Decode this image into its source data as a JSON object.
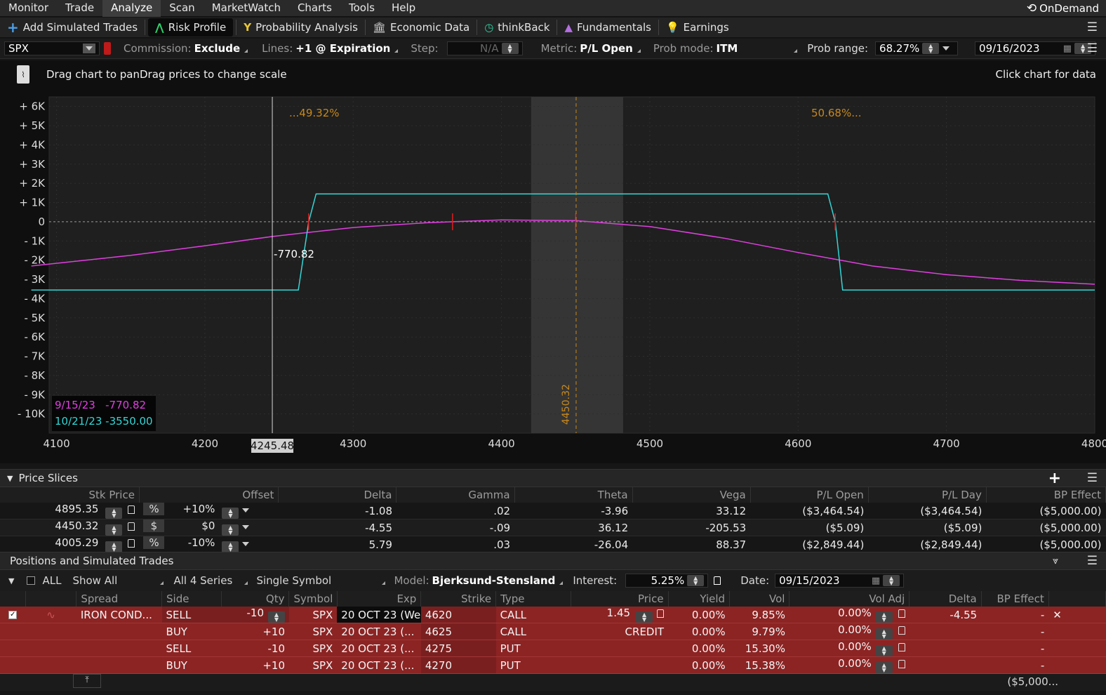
{
  "menu": [
    "Monitor",
    "Trade",
    "Analyze",
    "Scan",
    "MarketWatch",
    "Charts",
    "Tools",
    "Help"
  ],
  "menu_active": "Analyze",
  "ondemand": "OnDemand",
  "toolbar": {
    "add_simulated": "Add Simulated Trades",
    "risk_profile": "Risk Profile",
    "probability": "Probability Analysis",
    "economic": "Economic Data",
    "thinkback": "thinkBack",
    "fundamentals": "Fundamentals",
    "earnings": "Earnings"
  },
  "params": {
    "symbol": "SPX",
    "commission_label": "Commission:",
    "commission_value": "Exclude",
    "lines_label": "Lines:",
    "lines_value": "+1 @ Expiration",
    "step_label": "Step:",
    "step_value": "N/A",
    "metric_label": "Metric:",
    "metric_value": "P/L Open",
    "probmode_label": "Prob mode:",
    "probmode_value": "ITM",
    "probrange_label": "Prob range:",
    "probrange_value": "68.27%",
    "date_value": "09/16/2023"
  },
  "chart": {
    "hint": "Drag chart to panDrag prices to change scale",
    "click_hint": "Click chart for data",
    "left_prob": "...49.32%",
    "right_prob": "50.68%...",
    "price_marker": "4450.32",
    "cursor_price": "4245.48",
    "cursor_value": "-770.82",
    "legend": [
      {
        "date": "9/15/23",
        "value": "-770.82",
        "color": "#e040e0"
      },
      {
        "date": "10/21/23",
        "value": "-3550.00",
        "color": "#33d6d6"
      }
    ]
  },
  "chart_data": {
    "type": "line",
    "x_ticks": [
      4100,
      4200,
      4300,
      4400,
      4500,
      4600,
      4700,
      4800
    ],
    "y_ticks": [
      "+ 6K",
      "+ 5K",
      "+ 4K",
      "+ 3K",
      "+ 2K",
      "+ 1K",
      "0",
      "- 1K",
      "- 2K",
      "- 3K",
      "- 4K",
      "- 5K",
      "- 6K",
      "- 7K",
      "- 8K",
      "- 9K",
      "- 10K"
    ],
    "xlim": [
      4095,
      4800
    ],
    "ylim": [
      -11000,
      6500
    ],
    "shaded_range": [
      4420,
      4482
    ],
    "series": [
      {
        "color": "#e040e0",
        "x": [
          4083,
          4150,
          4200,
          4245,
          4270,
          4300,
          4350,
          4400,
          4450,
          4500,
          4550,
          4600,
          4650,
          4700,
          4750,
          4800
        ],
        "y": [
          -2300,
          -1750,
          -1250,
          -770,
          -550,
          -300,
          -50,
          100,
          60,
          -250,
          -850,
          -1600,
          -2300,
          -2750,
          -3050,
          -3250
        ]
      },
      {
        "color": "#33d6d6",
        "x": [
          4083,
          4263,
          4270,
          4275,
          4620,
          4625,
          4630,
          4800
        ],
        "y": [
          -3550,
          -3550,
          0,
          1450,
          1450,
          0,
          -3550,
          -3550
        ]
      }
    ]
  },
  "price_slices": {
    "title": "Price Slices",
    "columns": [
      "Stk Price",
      "Offset",
      "Delta",
      "Gamma",
      "Theta",
      "Vega",
      "P/L Open",
      "P/L Day",
      "BP Effect"
    ],
    "rows": [
      {
        "price": "4895.35",
        "mode": "%",
        "offset": "+10%",
        "delta": "-1.08",
        "gamma": ".02",
        "theta": "-3.96",
        "vega": "33.12",
        "plopen": "($3,464.54)",
        "plday": "($3,464.54)",
        "bp": "($5,000.00)"
      },
      {
        "price": "4450.32",
        "mode": "$",
        "offset": "$0",
        "delta": "-4.55",
        "gamma": "-.09",
        "theta": "36.12",
        "vega": "-205.53",
        "plopen": "($5.09)",
        "plday": "($5.09)",
        "bp": "($5,000.00)"
      },
      {
        "price": "4005.29",
        "mode": "%",
        "offset": "-10%",
        "delta": "5.79",
        "gamma": ".03",
        "theta": "-26.04",
        "vega": "88.37",
        "plopen": "($2,849.44)",
        "plday": "($2,849.44)",
        "bp": "($5,000.00)"
      }
    ]
  },
  "positions": {
    "title": "Positions and Simulated Trades",
    "all_label": "ALL",
    "show_all": "Show All",
    "series": "All 4 Series",
    "single": "Single Symbol",
    "model_label": "Model:",
    "model_value": "Bjerksund-Stensland",
    "interest_label": "Interest:",
    "interest_value": "5.25%",
    "date_label": "Date:",
    "date_value": "09/15/2023",
    "columns": [
      "Spread",
      "Side",
      "Qty",
      "Symbol",
      "Exp",
      "Strike",
      "Type",
      "Price",
      "Yield",
      "Vol",
      "Vol Adj",
      "Delta",
      "BP Effect"
    ],
    "rows": [
      {
        "spread": "IRON COND...",
        "side": "SELL",
        "qty": "-10",
        "symbol": "SPX",
        "exp": "20 OCT 23 (We",
        "strike": "4620",
        "type": "CALL",
        "price": "1.45",
        "yield": "0.00%",
        "vol": "9.85%",
        "voladj": "0.00%",
        "delta": "-4.55",
        "bp": "-"
      },
      {
        "spread": "",
        "side": "BUY",
        "qty": "+10",
        "symbol": "SPX",
        "exp": "20 OCT 23 (...",
        "strike": "4625",
        "type": "CALL",
        "price": "CREDIT",
        "yield": "0.00%",
        "vol": "9.79%",
        "voladj": "0.00%",
        "delta": "",
        "bp": "-"
      },
      {
        "spread": "",
        "side": "SELL",
        "qty": "-10",
        "symbol": "SPX",
        "exp": "20 OCT 23 (...",
        "strike": "4275",
        "type": "PUT",
        "price": "",
        "yield": "0.00%",
        "vol": "15.30%",
        "voladj": "0.00%",
        "delta": "",
        "bp": "-"
      },
      {
        "spread": "",
        "side": "BUY",
        "qty": "+10",
        "symbol": "SPX",
        "exp": "20 OCT 23 (...",
        "strike": "4270",
        "type": "PUT",
        "price": "",
        "yield": "0.00%",
        "vol": "15.38%",
        "voladj": "0.00%",
        "delta": "",
        "bp": "-"
      }
    ],
    "total_bp": "($5,000..."
  }
}
